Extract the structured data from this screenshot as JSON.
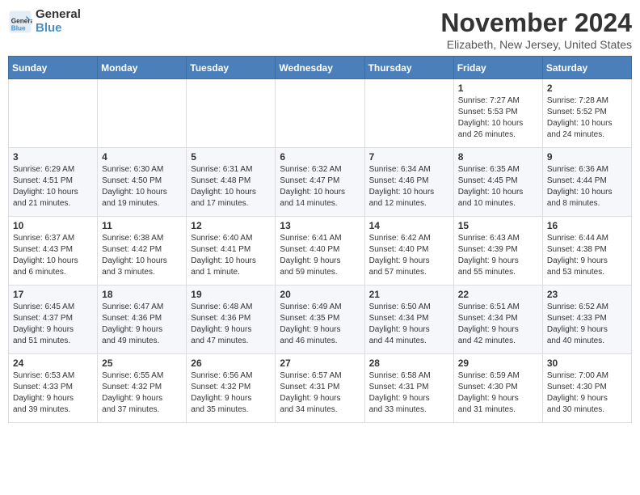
{
  "header": {
    "logo_line1": "General",
    "logo_line2": "Blue",
    "month_title": "November 2024",
    "subtitle": "Elizabeth, New Jersey, United States"
  },
  "days_of_week": [
    "Sunday",
    "Monday",
    "Tuesday",
    "Wednesday",
    "Thursday",
    "Friday",
    "Saturday"
  ],
  "weeks": [
    [
      {
        "day": "",
        "info": ""
      },
      {
        "day": "",
        "info": ""
      },
      {
        "day": "",
        "info": ""
      },
      {
        "day": "",
        "info": ""
      },
      {
        "day": "",
        "info": ""
      },
      {
        "day": "1",
        "info": "Sunrise: 7:27 AM\nSunset: 5:53 PM\nDaylight: 10 hours\nand 26 minutes."
      },
      {
        "day": "2",
        "info": "Sunrise: 7:28 AM\nSunset: 5:52 PM\nDaylight: 10 hours\nand 24 minutes."
      }
    ],
    [
      {
        "day": "3",
        "info": "Sunrise: 6:29 AM\nSunset: 4:51 PM\nDaylight: 10 hours\nand 21 minutes."
      },
      {
        "day": "4",
        "info": "Sunrise: 6:30 AM\nSunset: 4:50 PM\nDaylight: 10 hours\nand 19 minutes."
      },
      {
        "day": "5",
        "info": "Sunrise: 6:31 AM\nSunset: 4:48 PM\nDaylight: 10 hours\nand 17 minutes."
      },
      {
        "day": "6",
        "info": "Sunrise: 6:32 AM\nSunset: 4:47 PM\nDaylight: 10 hours\nand 14 minutes."
      },
      {
        "day": "7",
        "info": "Sunrise: 6:34 AM\nSunset: 4:46 PM\nDaylight: 10 hours\nand 12 minutes."
      },
      {
        "day": "8",
        "info": "Sunrise: 6:35 AM\nSunset: 4:45 PM\nDaylight: 10 hours\nand 10 minutes."
      },
      {
        "day": "9",
        "info": "Sunrise: 6:36 AM\nSunset: 4:44 PM\nDaylight: 10 hours\nand 8 minutes."
      }
    ],
    [
      {
        "day": "10",
        "info": "Sunrise: 6:37 AM\nSunset: 4:43 PM\nDaylight: 10 hours\nand 6 minutes."
      },
      {
        "day": "11",
        "info": "Sunrise: 6:38 AM\nSunset: 4:42 PM\nDaylight: 10 hours\nand 3 minutes."
      },
      {
        "day": "12",
        "info": "Sunrise: 6:40 AM\nSunset: 4:41 PM\nDaylight: 10 hours\nand 1 minute."
      },
      {
        "day": "13",
        "info": "Sunrise: 6:41 AM\nSunset: 4:40 PM\nDaylight: 9 hours\nand 59 minutes."
      },
      {
        "day": "14",
        "info": "Sunrise: 6:42 AM\nSunset: 4:40 PM\nDaylight: 9 hours\nand 57 minutes."
      },
      {
        "day": "15",
        "info": "Sunrise: 6:43 AM\nSunset: 4:39 PM\nDaylight: 9 hours\nand 55 minutes."
      },
      {
        "day": "16",
        "info": "Sunrise: 6:44 AM\nSunset: 4:38 PM\nDaylight: 9 hours\nand 53 minutes."
      }
    ],
    [
      {
        "day": "17",
        "info": "Sunrise: 6:45 AM\nSunset: 4:37 PM\nDaylight: 9 hours\nand 51 minutes."
      },
      {
        "day": "18",
        "info": "Sunrise: 6:47 AM\nSunset: 4:36 PM\nDaylight: 9 hours\nand 49 minutes."
      },
      {
        "day": "19",
        "info": "Sunrise: 6:48 AM\nSunset: 4:36 PM\nDaylight: 9 hours\nand 47 minutes."
      },
      {
        "day": "20",
        "info": "Sunrise: 6:49 AM\nSunset: 4:35 PM\nDaylight: 9 hours\nand 46 minutes."
      },
      {
        "day": "21",
        "info": "Sunrise: 6:50 AM\nSunset: 4:34 PM\nDaylight: 9 hours\nand 44 minutes."
      },
      {
        "day": "22",
        "info": "Sunrise: 6:51 AM\nSunset: 4:34 PM\nDaylight: 9 hours\nand 42 minutes."
      },
      {
        "day": "23",
        "info": "Sunrise: 6:52 AM\nSunset: 4:33 PM\nDaylight: 9 hours\nand 40 minutes."
      }
    ],
    [
      {
        "day": "24",
        "info": "Sunrise: 6:53 AM\nSunset: 4:33 PM\nDaylight: 9 hours\nand 39 minutes."
      },
      {
        "day": "25",
        "info": "Sunrise: 6:55 AM\nSunset: 4:32 PM\nDaylight: 9 hours\nand 37 minutes."
      },
      {
        "day": "26",
        "info": "Sunrise: 6:56 AM\nSunset: 4:32 PM\nDaylight: 9 hours\nand 35 minutes."
      },
      {
        "day": "27",
        "info": "Sunrise: 6:57 AM\nSunset: 4:31 PM\nDaylight: 9 hours\nand 34 minutes."
      },
      {
        "day": "28",
        "info": "Sunrise: 6:58 AM\nSunset: 4:31 PM\nDaylight: 9 hours\nand 33 minutes."
      },
      {
        "day": "29",
        "info": "Sunrise: 6:59 AM\nSunset: 4:30 PM\nDaylight: 9 hours\nand 31 minutes."
      },
      {
        "day": "30",
        "info": "Sunrise: 7:00 AM\nSunset: 4:30 PM\nDaylight: 9 hours\nand 30 minutes."
      }
    ]
  ]
}
